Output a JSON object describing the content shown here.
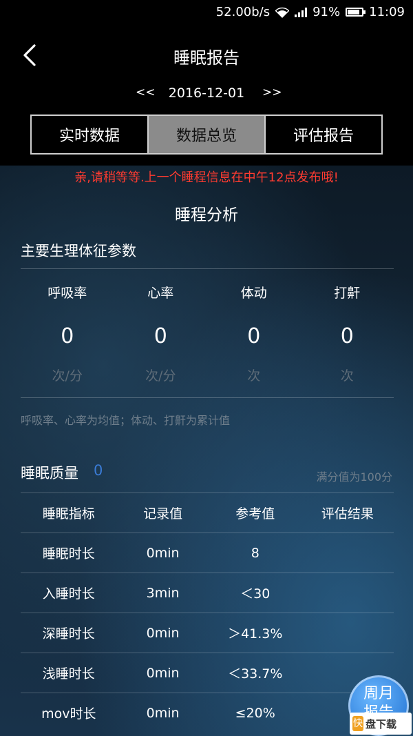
{
  "status_bar": {
    "network_speed": "52.00b/s",
    "battery_percent": "91%",
    "battery_level": 0.91,
    "time": "11:09",
    "icons": [
      "wifi-icon",
      "signal-icon",
      "battery-icon"
    ]
  },
  "header": {
    "title": "睡眠报告",
    "back_icon": "chevron-left-icon",
    "prev_label": "<<",
    "next_label": ">>",
    "date": "2016-12-01",
    "tabs": [
      {
        "label": "实时数据",
        "active": false
      },
      {
        "label": "数据总览",
        "active": true
      },
      {
        "label": "评估报告",
        "active": false
      }
    ]
  },
  "notice": "亲,请稍等等.上一个睡程信息在中午12点发布哦!",
  "section_title": "睡程分析",
  "vitals": {
    "title": "主要生理体征参数",
    "items": [
      {
        "label": "呼吸率",
        "value": "0",
        "unit": "次/分"
      },
      {
        "label": "心率",
        "value": "0",
        "unit": "次/分"
      },
      {
        "label": "体动",
        "value": "0",
        "unit": "次"
      },
      {
        "label": "打鼾",
        "value": "0",
        "unit": "次"
      }
    ],
    "note": "呼吸率、心率为均值；体动、打鼾为累计值"
  },
  "quality": {
    "label": "睡眠质量",
    "score": "0",
    "note": "满分值为100分",
    "columns": [
      "睡眠指标",
      "记录值",
      "参考值",
      "评估结果"
    ],
    "rows": [
      [
        "睡眠时长",
        "0min",
        "8",
        ""
      ],
      [
        "入睡时长",
        "3min",
        "＜30",
        ""
      ],
      [
        "深睡时长",
        "0min",
        "＞41.3%",
        ""
      ],
      [
        "浅睡时长",
        "0min",
        "＜33.7%",
        ""
      ],
      [
        "mov时长",
        "0min",
        "≤20%",
        ""
      ]
    ]
  },
  "fab": {
    "line1": "周月",
    "line2": "报告"
  },
  "watermark": {
    "logo": "快",
    "text": "盘下载"
  },
  "colors": {
    "notice": "#ff3b30",
    "score": "#3a7bd5",
    "active_tab": "#8b8b8b",
    "fab": "#2a86e8"
  }
}
